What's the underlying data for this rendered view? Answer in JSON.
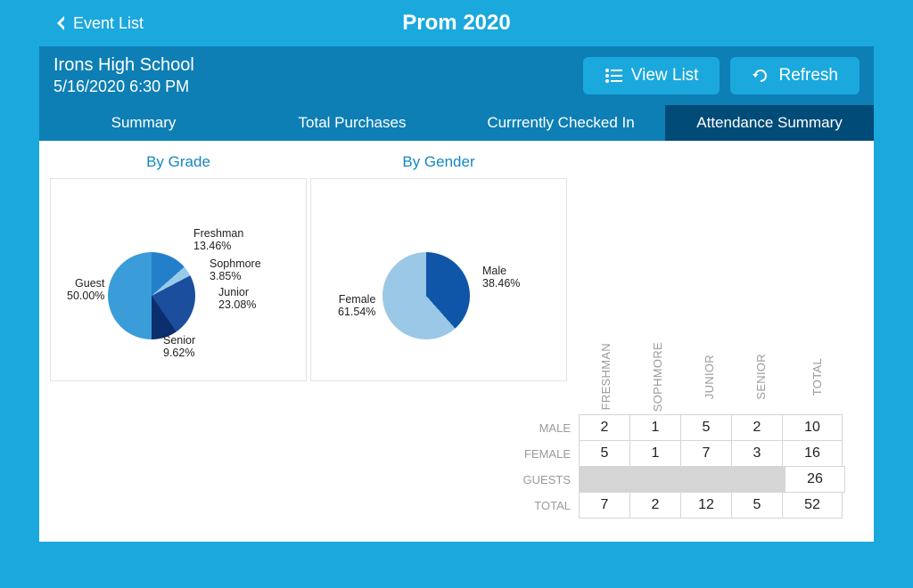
{
  "header": {
    "back_label": "Event List",
    "title": "Prom 2020"
  },
  "info": {
    "school": "Irons High School",
    "datetime": "5/16/2020 6:30 PM",
    "view_list_label": "View List",
    "refresh_label": "Refresh"
  },
  "tabs": [
    {
      "label": "Summary"
    },
    {
      "label": "Total Purchases"
    },
    {
      "label": "Currrently Checked In"
    },
    {
      "label": "Attendance Summary"
    }
  ],
  "charts": {
    "by_grade_title": "By Grade",
    "by_gender_title": "By Gender"
  },
  "chart_data": [
    {
      "type": "pie",
      "title": "By Grade",
      "series": [
        {
          "name": "Freshman",
          "value": 13.46,
          "label": "13.46%"
        },
        {
          "name": "Sophmore",
          "value": 3.85,
          "label": "3.85%"
        },
        {
          "name": "Junior",
          "value": 23.08,
          "label": "23.08%"
        },
        {
          "name": "Senior",
          "value": 9.62,
          "label": "9.62%"
        },
        {
          "name": "Guest",
          "value": 50.0,
          "label": "50.00%"
        }
      ]
    },
    {
      "type": "pie",
      "title": "By Gender",
      "series": [
        {
          "name": "Male",
          "value": 38.46,
          "label": "38.46%"
        },
        {
          "name": "Female",
          "value": 61.54,
          "label": "61.54%"
        }
      ]
    }
  ],
  "table": {
    "columns": [
      "FRESHMAN",
      "SOPHMORE",
      "JUNIOR",
      "SENIOR",
      "TOTAL"
    ],
    "rows": [
      {
        "label": "MALE",
        "cells": [
          "2",
          "1",
          "5",
          "2",
          "10"
        ]
      },
      {
        "label": "FEMALE",
        "cells": [
          "5",
          "1",
          "7",
          "3",
          "16"
        ]
      },
      {
        "label": "GUESTS",
        "cells": [
          "",
          "",
          "",
          "",
          "26"
        ],
        "merged": true
      },
      {
        "label": "TOTAL",
        "cells": [
          "7",
          "2",
          "12",
          "5",
          "52"
        ]
      }
    ]
  }
}
